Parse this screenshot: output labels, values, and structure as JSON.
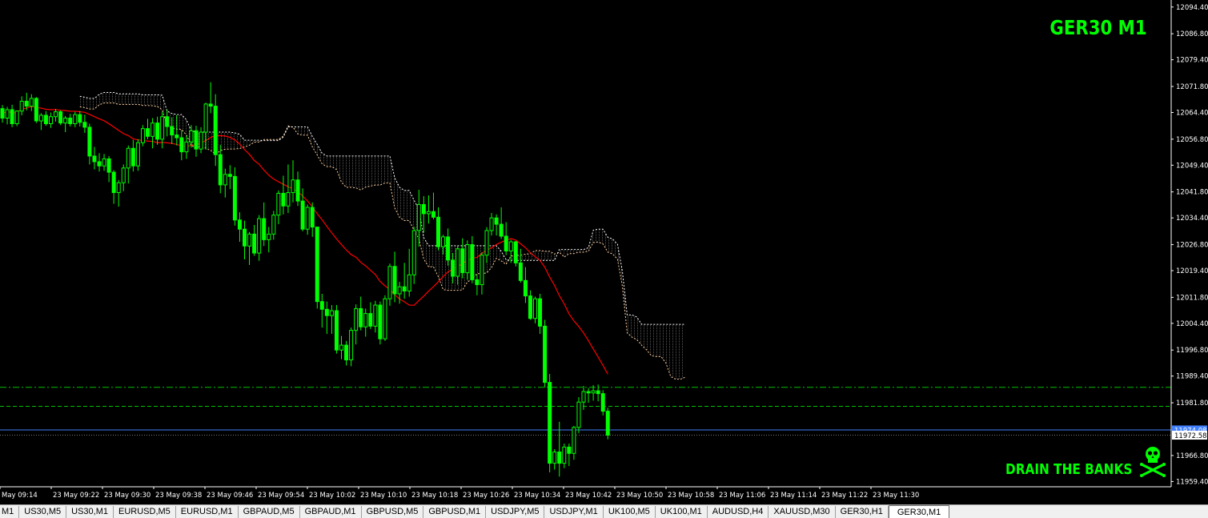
{
  "chart_title": "GER30 M1",
  "signature_text": "DRAIN THE BANKS",
  "skull_icon": "skull-crossbones-icon",
  "colors": {
    "background": "#000000",
    "bull_candle": "#e8f5a0",
    "bear_candle": "#00ff00",
    "ma_line": "#ff0000",
    "kumo": "#ffffff",
    "level_dashed": "#00c000",
    "bid_line": "#4080ff",
    "overlay_text": "#00ff00",
    "axis": "#ffffff"
  },
  "price_axis": {
    "labels": [
      "12094.40",
      "12086.80",
      "12079.40",
      "12071.80",
      "12064.40",
      "12056.80",
      "12049.40",
      "12041.80",
      "12034.40",
      "12026.80",
      "12019.40",
      "12011.80",
      "12004.40",
      "11996.80",
      "11989.40",
      "11981.80",
      "11974.08",
      "11972.58",
      "11966.80",
      "11959.40"
    ],
    "current_price": "11972.58",
    "level_tag": "11974.08"
  },
  "time_axis": {
    "labels": [
      "May 09:14",
      "23 May 09:22",
      "23 May 09:30",
      "23 May 09:38",
      "23 May 09:46",
      "23 May 09:54",
      "23 May 10:02",
      "23 May 10:10",
      "23 May 10:18",
      "23 May 10:26",
      "23 May 10:34",
      "23 May 10:42",
      "23 May 10:50",
      "23 May 10:58",
      "23 May 11:06",
      "23 May 11:14",
      "23 May 11:22",
      "23 May 11:30"
    ]
  },
  "levels": [
    11986.2,
    11980.8,
    11974.08
  ],
  "tabs": [
    "M1",
    "US30,M5",
    "US30,M1",
    "EURUSD,M5",
    "EURUSD,M1",
    "GBPAUD,M5",
    "GBPAUD,M1",
    "GBPUSD,M5",
    "GBPUSD,M1",
    "USDJPY,M5",
    "USDJPY,M1",
    "UK100,M5",
    "UK100,M1",
    "AUDUSD,H4",
    "XAUUSD,M30",
    "GER30,H1",
    "GER30,M1"
  ],
  "active_tab": "GER30,M1",
  "chart_data": {
    "type": "candlestick",
    "title": "GER30 M1",
    "ylim": [
      11957.9,
      12096.4
    ],
    "candles": [
      [
        12065.5,
        12066.5,
        12061.5,
        12062.8
      ],
      [
        12062.8,
        12066,
        12061,
        12065.2
      ],
      [
        12065.2,
        12066.6,
        12060.2,
        12061.2
      ],
      [
        12061.2,
        12065,
        12060.5,
        12064.8
      ],
      [
        12064.8,
        12069,
        12063.6,
        12067.6
      ],
      [
        12067.6,
        12070,
        12065,
        12066.2
      ],
      [
        12066.2,
        12069.6,
        12064.8,
        12068.4
      ],
      [
        12068.4,
        12068.8,
        12061.4,
        12062
      ],
      [
        12062,
        12064.2,
        12059.4,
        12063.6
      ],
      [
        12063.6,
        12064.8,
        12060.6,
        12061.2
      ],
      [
        12061.2,
        12064.4,
        12060,
        12063.2
      ],
      [
        12063.2,
        12065.4,
        12061.8,
        12064.6
      ],
      [
        12064.6,
        12065,
        12060.8,
        12061.4
      ],
      [
        12061.4,
        12063.4,
        12058.8,
        12062.8
      ],
      [
        12062.8,
        12064,
        12060.4,
        12061.2
      ],
      [
        12061.2,
        12064.6,
        12060.2,
        12063.8
      ],
      [
        12063.8,
        12064.8,
        12060.4,
        12061.6
      ],
      [
        12061.6,
        12063.8,
        12058.6,
        12060.2
      ],
      [
        12060.2,
        12061.2,
        12049.6,
        12052
      ],
      [
        12052,
        12054.6,
        12048.2,
        12050.4
      ],
      [
        12050.4,
        12052.8,
        12047.6,
        12049.2
      ],
      [
        12049.2,
        12052.6,
        12047.8,
        12051.2
      ],
      [
        12051.2,
        12052,
        12044.6,
        12047.4
      ],
      [
        12047.4,
        12048,
        12038.4,
        12041.6
      ],
      [
        12041.6,
        12045.2,
        12037.6,
        12044.4
      ],
      [
        12044.4,
        12049.6,
        12042,
        12048.6
      ],
      [
        12048.6,
        12055,
        12044.2,
        12054.2
      ],
      [
        12054.2,
        12056.6,
        12047.6,
        12049.2
      ],
      [
        12049.2,
        12056.8,
        12047.8,
        12055.8
      ],
      [
        12055.8,
        12060.8,
        12054.8,
        12059.8
      ],
      [
        12059.8,
        12062.6,
        12056.8,
        12057.6
      ],
      [
        12057.6,
        12062.8,
        12054.2,
        12061.4
      ],
      [
        12061.4,
        12063.2,
        12055.2,
        12056.8
      ],
      [
        12056.8,
        12064.6,
        12054.2,
        12063.2
      ],
      [
        12063.2,
        12065.2,
        12057.6,
        12060.4
      ],
      [
        12060.4,
        12063,
        12055.4,
        12058
      ],
      [
        12058,
        12063.6,
        12055,
        12057.2
      ],
      [
        12057.2,
        12059.4,
        12050.8,
        12053.2
      ],
      [
        12053.2,
        12057.8,
        12051.2,
        12056
      ],
      [
        12056,
        12060.8,
        12054.4,
        12059.2
      ],
      [
        12059.2,
        12060.6,
        12051.8,
        12054
      ],
      [
        12054,
        12060.2,
        12052.8,
        12058.8
      ],
      [
        12058.8,
        12067.2,
        12053.8,
        12066.8
      ],
      [
        12066.8,
        12073,
        12064.2,
        12066.2
      ],
      [
        12066.2,
        12069.6,
        12049.2,
        12052.4
      ],
      [
        12052.4,
        12055.2,
        12041.4,
        12043.8
      ],
      [
        12043.8,
        12048.4,
        12040.2,
        12046.8
      ],
      [
        12046.8,
        12049.4,
        12042.6,
        12046.2
      ],
      [
        12046.2,
        12048.8,
        12032.2,
        12033.8
      ],
      [
        12033.8,
        12036,
        12027.6,
        12031.2
      ],
      [
        12031.2,
        12033.6,
        12022.6,
        12026.4
      ],
      [
        12026.4,
        12030.4,
        12021,
        12029.8
      ],
      [
        12029.8,
        12032.4,
        12023.6,
        12024.4
      ],
      [
        12024.4,
        12035.2,
        12022.2,
        12034.2
      ],
      [
        12034.2,
        12038.8,
        12026.4,
        12028.2
      ],
      [
        12028.2,
        12031.8,
        12024.6,
        12029.8
      ],
      [
        12029.8,
        12036.4,
        12028.2,
        12035.2
      ],
      [
        12035.2,
        12042.2,
        12032.6,
        12041.4
      ],
      [
        12041.4,
        12046.4,
        12035.4,
        12037.8
      ],
      [
        12037.8,
        12049.6,
        12035.8,
        12041.6
      ],
      [
        12041.6,
        12050.8,
        12038.8,
        12045.2
      ],
      [
        12045.2,
        12047.6,
        12037.8,
        12039.2
      ],
      [
        12039.2,
        12042.8,
        12030.6,
        12031.2
      ],
      [
        12031.2,
        12038.2,
        12029.6,
        12037.4
      ],
      [
        12037.4,
        12038.8,
        12029,
        12031.8
      ],
      [
        12031.8,
        12027.6,
        12008.6,
        12010.6
      ],
      [
        12010.6,
        12012.8,
        12003.2,
        12008.4
      ],
      [
        12008.4,
        12010.6,
        12001.4,
        12006.6
      ],
      [
        12006.6,
        12009.6,
        12001.4,
        12008
      ],
      [
        12008,
        12009.6,
        11995.8,
        11996.8
      ],
      [
        11996.8,
        12000.8,
        11994.2,
        11998.2
      ],
      [
        11998.2,
        11999.4,
        11992.4,
        11994
      ],
      [
        11994,
        12003.2,
        11992.2,
        12002.4
      ],
      [
        12002.4,
        12009.8,
        11998.4,
        12008.6
      ],
      [
        12008.6,
        12012,
        12002.4,
        12003.4
      ],
      [
        12003.4,
        12008.6,
        12000.6,
        12007.2
      ],
      [
        12007.2,
        12010.4,
        12002.8,
        12003.6
      ],
      [
        12003.6,
        12010.8,
        12001.8,
        12009.6
      ],
      [
        12009.6,
        12010.6,
        11998.4,
        12000
      ],
      [
        12000,
        12012.4,
        11999.4,
        12011.4
      ],
      [
        12011.4,
        12021.4,
        12009.4,
        12020.6
      ],
      [
        12020.6,
        12024.8,
        12010.4,
        12012.8
      ],
      [
        12012.8,
        12016.2,
        12010,
        12014.8
      ],
      [
        12014.8,
        12021.6,
        12011.4,
        12013.6
      ],
      [
        12013.6,
        12025.6,
        12012,
        12018.2
      ],
      [
        12018.2,
        12031.8,
        12015.6,
        12030.8
      ],
      [
        12030.8,
        12042.4,
        12026.2,
        12038.2
      ],
      [
        12038.2,
        12040.6,
        12030.2,
        12035.6
      ],
      [
        12035.6,
        12040.8,
        12032.8,
        12036.2
      ],
      [
        12036.2,
        12041.6,
        12034,
        12034.6
      ],
      [
        12034.6,
        12037.4,
        12025.2,
        12026.2
      ],
      [
        12026.2,
        12029.6,
        12024,
        12029
      ],
      [
        12029,
        12031.4,
        12020.8,
        12022.4
      ],
      [
        12022.4,
        12024.4,
        12015.8,
        12017.8
      ],
      [
        12017.8,
        12026.6,
        12015.4,
        12025.6
      ],
      [
        12025.6,
        12028.6,
        12017.2,
        12018.8
      ],
      [
        12018.8,
        12028,
        12016.8,
        12026.8
      ],
      [
        12026.8,
        12029.2,
        12015.8,
        12016.8
      ],
      [
        12016.8,
        12018.4,
        12012.4,
        12015.4
      ],
      [
        12015.4,
        12024.6,
        12012.6,
        12023.8
      ],
      [
        12023.8,
        12031.8,
        12021.6,
        12030.8
      ],
      [
        12030.8,
        12035.8,
        12029.4,
        12034.4
      ],
      [
        12034.4,
        12035.4,
        12029.4,
        12032.6
      ],
      [
        12032.6,
        12037.4,
        12028.4,
        12029.2
      ],
      [
        12029.2,
        12033.2,
        12023.8,
        12025
      ],
      [
        12025,
        12028.2,
        12021.6,
        12027.6
      ],
      [
        12027.6,
        12027.8,
        12020.6,
        12021.6
      ],
      [
        12021.6,
        12025.6,
        12016,
        12016.6
      ],
      [
        12016.6,
        12020.4,
        12010.2,
        12012.2
      ],
      [
        12012.2,
        12013.8,
        12005.4,
        12005.8
      ],
      [
        12005.8,
        12012,
        12004.4,
        12011.4
      ],
      [
        12011.4,
        12012.8,
        12001.4,
        12003.6
      ],
      [
        12003.6,
        12005.4,
        11986.2,
        11987.6
      ],
      [
        11987.6,
        11990,
        11962,
        11964.6
      ],
      [
        11964.6,
        11968.6,
        11962.8,
        11967.8
      ],
      [
        11967.8,
        11976.4,
        11960.8,
        11964.6
      ],
      [
        11964.6,
        11970.2,
        11963.2,
        11969.2
      ],
      [
        11969.2,
        11970.2,
        11963.8,
        11967.4
      ],
      [
        11967.4,
        11975.2,
        11965.6,
        11974.8
      ],
      [
        11974.8,
        11983.4,
        11973.2,
        11982
      ],
      [
        11982,
        11986.6,
        11979.8,
        11985
      ],
      [
        11985,
        11986,
        11981.8,
        11984.6
      ],
      [
        11984.6,
        11986.8,
        11982.4,
        11985.2
      ],
      [
        11985.2,
        11987,
        11982.2,
        11984.4
      ],
      [
        11984.4,
        11985.4,
        11978.2,
        11979.4
      ],
      [
        11979.4,
        11980.4,
        11971.4,
        11972.6
      ]
    ]
  }
}
